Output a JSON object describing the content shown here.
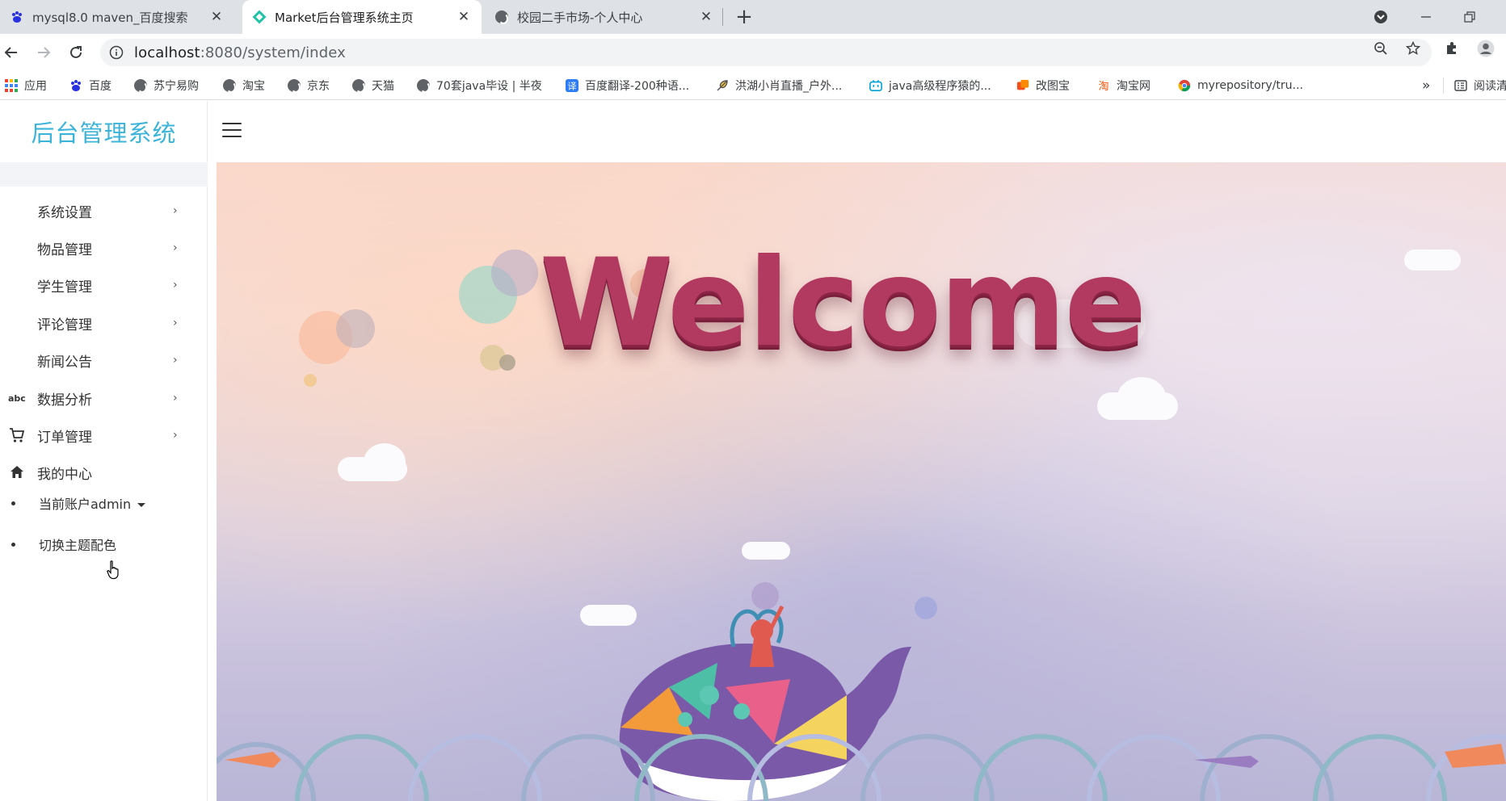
{
  "browser": {
    "tabs": [
      {
        "title": "mysql8.0 maven_百度搜索",
        "active": false,
        "favicon": "baidu-paw-icon"
      },
      {
        "title": "Market后台管理系统主页",
        "active": true,
        "favicon": "market-diamond-icon"
      },
      {
        "title": "校园二手市场-个人中心",
        "active": false,
        "favicon": "globe-icon"
      }
    ],
    "address": {
      "host": "localhost",
      "rest": ":8080/system/index"
    },
    "bookmarks": [
      {
        "label": "应用",
        "icon": "apps-grid-icon"
      },
      {
        "label": "百度",
        "icon": "baidu-paw-icon"
      },
      {
        "label": "苏宁易购",
        "icon": "globe-icon"
      },
      {
        "label": "淘宝",
        "icon": "globe-icon"
      },
      {
        "label": "京东",
        "icon": "globe-icon"
      },
      {
        "label": "天猫",
        "icon": "globe-icon"
      },
      {
        "label": "70套java毕设 | 半夜",
        "icon": "globe-icon"
      },
      {
        "label": "百度翻译-200种语...",
        "icon": "translate-icon"
      },
      {
        "label": "洪湖小肖直播_户外...",
        "icon": "feather-icon"
      },
      {
        "label": "java高级程序猿的...",
        "icon": "bilibili-icon"
      },
      {
        "label": "改图宝",
        "icon": "image-icon"
      },
      {
        "label": "淘宝网",
        "icon": "taobao-icon"
      },
      {
        "label": "myrepository/tru...",
        "icon": "chrome-icon"
      }
    ],
    "more_bookmarks": "»",
    "reading_list": "阅读清单"
  },
  "admin": {
    "brand": "后台管理系统",
    "menu": [
      {
        "label": "系统设置",
        "icon": "",
        "chevron": "›"
      },
      {
        "label": "物品管理",
        "icon": "",
        "chevron": "›"
      },
      {
        "label": "学生管理",
        "icon": "",
        "chevron": "›"
      },
      {
        "label": "评论管理",
        "icon": "",
        "chevron": "›"
      },
      {
        "label": "新闻公告",
        "icon": "",
        "chevron": "›"
      },
      {
        "label": "数据分析",
        "icon": "abc-icon",
        "icon_text": "abc",
        "chevron": "›"
      },
      {
        "label": "订单管理",
        "icon": "cart-icon",
        "chevron": "›"
      },
      {
        "label": "我的中心",
        "icon": "home-icon",
        "chevron": ""
      }
    ],
    "account": {
      "label": "当前账户admin"
    },
    "theme_switch": {
      "label": "切换主题配色"
    }
  },
  "banner": {
    "headline": "Welcome",
    "headline_color": "#b23a60",
    "brand_color": "#3cb4da"
  }
}
